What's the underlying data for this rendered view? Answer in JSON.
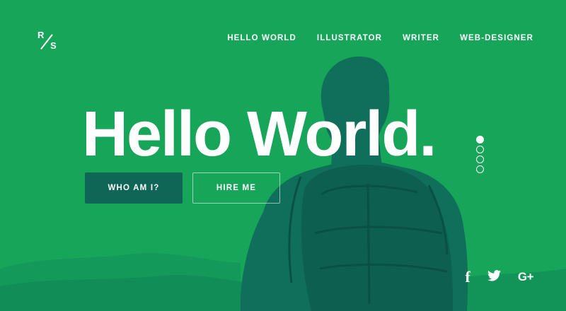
{
  "colors": {
    "background": "#17a55a",
    "silhouette": "#0f6f5a",
    "primary_button": "#0f6657",
    "text": "#ffffff"
  },
  "logo": {
    "line1": "R",
    "line2": "S"
  },
  "nav": {
    "items": [
      {
        "label": "HELLO WORLD"
      },
      {
        "label": "ILLUSTRATOR"
      },
      {
        "label": "WRITER"
      },
      {
        "label": "WEB-DESIGNER"
      }
    ]
  },
  "hero": {
    "title": "Hello World.",
    "primary_button": "WHO AM I?",
    "secondary_button": "HIRE ME"
  },
  "slider": {
    "count": 4,
    "active_index": 0
  },
  "social": {
    "facebook": "f",
    "google_plus": "G+",
    "icons": [
      "facebook-icon",
      "twitter-icon",
      "google-plus-icon"
    ]
  }
}
